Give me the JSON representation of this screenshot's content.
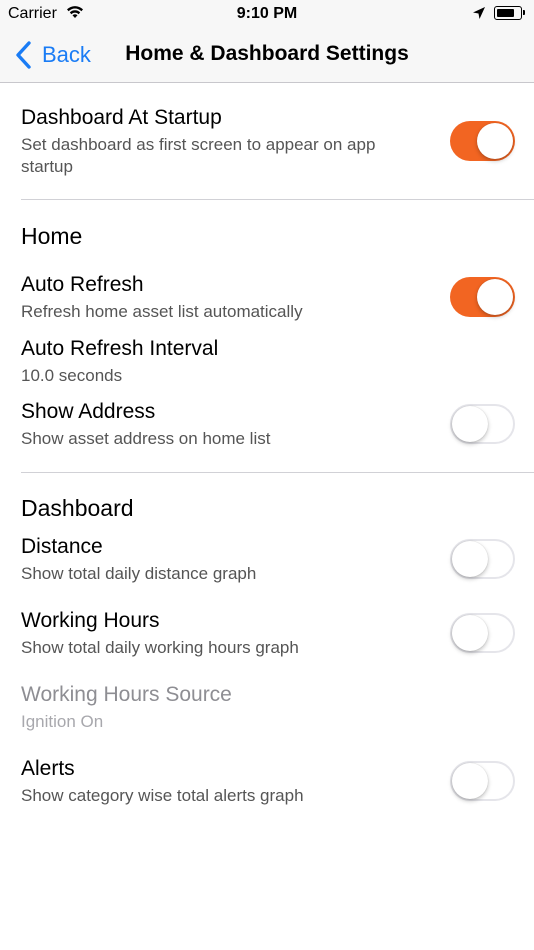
{
  "status_bar": {
    "carrier": "Carrier",
    "time": "9:10 PM"
  },
  "nav": {
    "back_label": "Back",
    "title": "Home & Dashboard Settings"
  },
  "colors": {
    "accent": "#f26522",
    "link": "#1a7cf5"
  },
  "general": {
    "dashboard_at_startup": {
      "title": "Dashboard At Startup",
      "subtitle": "Set dashboard as first screen to appear on app startup",
      "enabled": true
    }
  },
  "home": {
    "header": "Home",
    "auto_refresh": {
      "title": "Auto Refresh",
      "subtitle": "Refresh home asset list automatically",
      "enabled": true
    },
    "auto_refresh_interval": {
      "title": "Auto Refresh Interval",
      "value": "10.0 seconds"
    },
    "show_address": {
      "title": "Show Address",
      "subtitle": "Show asset address on home list",
      "enabled": false
    }
  },
  "dashboard": {
    "header": "Dashboard",
    "distance": {
      "title": "Distance",
      "subtitle": "Show total daily distance graph",
      "enabled": false
    },
    "working_hours": {
      "title": "Working Hours",
      "subtitle": "Show total daily working hours graph",
      "enabled": false
    },
    "working_hours_source": {
      "title": "Working Hours Source",
      "value": "Ignition On"
    },
    "alerts": {
      "title": "Alerts",
      "subtitle": "Show category wise total alerts graph",
      "enabled": false
    }
  }
}
